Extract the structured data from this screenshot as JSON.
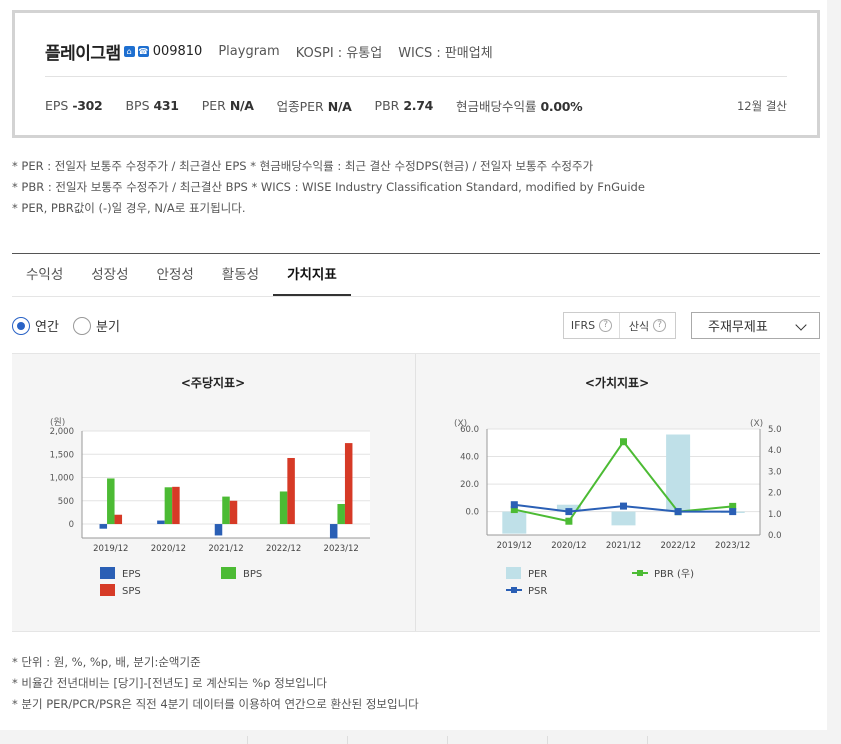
{
  "company": {
    "name": "플레이그램",
    "icons": [
      "home-icon",
      "ir-icon"
    ],
    "code": "009810",
    "eng_name": "Playgram",
    "market": "KOSPI : 유통업",
    "wics": "WICS : 판매업체",
    "metrics": [
      {
        "label": "EPS",
        "value": "-302"
      },
      {
        "label": "BPS",
        "value": "431"
      },
      {
        "label": "PER",
        "value": "N/A"
      },
      {
        "label": "업종PER",
        "value": "N/A"
      },
      {
        "label": "PBR",
        "value": "2.74"
      },
      {
        "label": "현금배당수익률",
        "value": "0.00%"
      }
    ],
    "settlement": "12월 결산"
  },
  "notes_top": [
    "* PER : 전일자 보통주 수정주가 / 최근결산 EPS * 현금배당수익률 : 최근 결산 수정DPS(현금) / 전일자 보통주 수정주가",
    "* PBR : 전일자 보통주 수정주가 / 최근결산 BPS * WICS : WISE Industry Classification Standard, modified by FnGuide",
    "* PER, PBR값이 (-)일 경우, N/A로 표기됩니다."
  ],
  "tabs": [
    {
      "label": "수익성",
      "active": false
    },
    {
      "label": "성장성",
      "active": false
    },
    {
      "label": "안정성",
      "active": false
    },
    {
      "label": "활동성",
      "active": false
    },
    {
      "label": "가치지표",
      "active": true
    }
  ],
  "controls": {
    "radio_annual": "연간",
    "radio_quarter": "분기",
    "selected_period": "annual",
    "opt_ifrs": "IFRS",
    "opt_formula": "산식",
    "help_glyph": "?",
    "statement_select": "주재무제표"
  },
  "chart_data": [
    {
      "type": "bar",
      "title": "<주당지표>",
      "unit_label": "(원)",
      "categories": [
        "2019/12",
        "2020/12",
        "2021/12",
        "2022/12",
        "2023/12"
      ],
      "ylim": [
        -300,
        2000
      ],
      "yticks": [
        0,
        500,
        1000,
        1500,
        2000
      ],
      "ytick_labels": [
        "0",
        "500",
        "1,000",
        "1,500",
        "2,000"
      ],
      "grid": true,
      "series": [
        {
          "name": "EPS",
          "color": "#2a5fb5",
          "values": [
            -100,
            75,
            -245,
            0,
            -310
          ]
        },
        {
          "name": "BPS",
          "color": "#4cbb34",
          "values": [
            980,
            790,
            590,
            700,
            431
          ]
        },
        {
          "name": "SPS",
          "color": "#d63a26",
          "values": [
            200,
            800,
            500,
            1420,
            1740
          ]
        }
      ]
    },
    {
      "type": "bar-line",
      "title": "<가치지표>",
      "left_unit": "(X)",
      "right_unit": "(X)",
      "categories": [
        "2019/12",
        "2020/12",
        "2021/12",
        "2022/12",
        "2023/12"
      ],
      "left_ylim": [
        -17,
        60
      ],
      "left_yticks": [
        0,
        20,
        40,
        60
      ],
      "left_ytick_labels": [
        "0.0",
        "20.0",
        "40.0",
        "60.0"
      ],
      "right_ylim": [
        0,
        5
      ],
      "right_yticks": [
        0,
        1,
        2,
        3,
        4,
        5
      ],
      "right_ytick_labels": [
        "0.0",
        "1.0",
        "2.0",
        "3.0",
        "4.0",
        "5.0"
      ],
      "grid": true,
      "series": [
        {
          "name": "PER",
          "kind": "bar",
          "axis": "left",
          "color": "#bfe0e8",
          "values": [
            -16,
            5,
            -10,
            56,
            -1
          ]
        },
        {
          "name": "PBR (우)",
          "kind": "line",
          "axis": "right",
          "color": "#4cbb34",
          "values": [
            1.2,
            0.65,
            4.4,
            1.1,
            1.35
          ]
        },
        {
          "name": "PSR",
          "kind": "line",
          "axis": "left",
          "color": "#2a5fb5",
          "values": [
            5,
            0,
            4,
            0,
            0
          ]
        }
      ]
    }
  ],
  "notes_bottom": [
    "* 단위 : 원, %, %p, 배, 분기:순액기준",
    "* 비율간 전년대비는 [당기]-[전년도] 로 계산되는 %p 정보입니다",
    "* 분기 PER/PCR/PSR은 직전 4분기 데이터를 이용하여 연간으로 환산된 정보입니다"
  ]
}
